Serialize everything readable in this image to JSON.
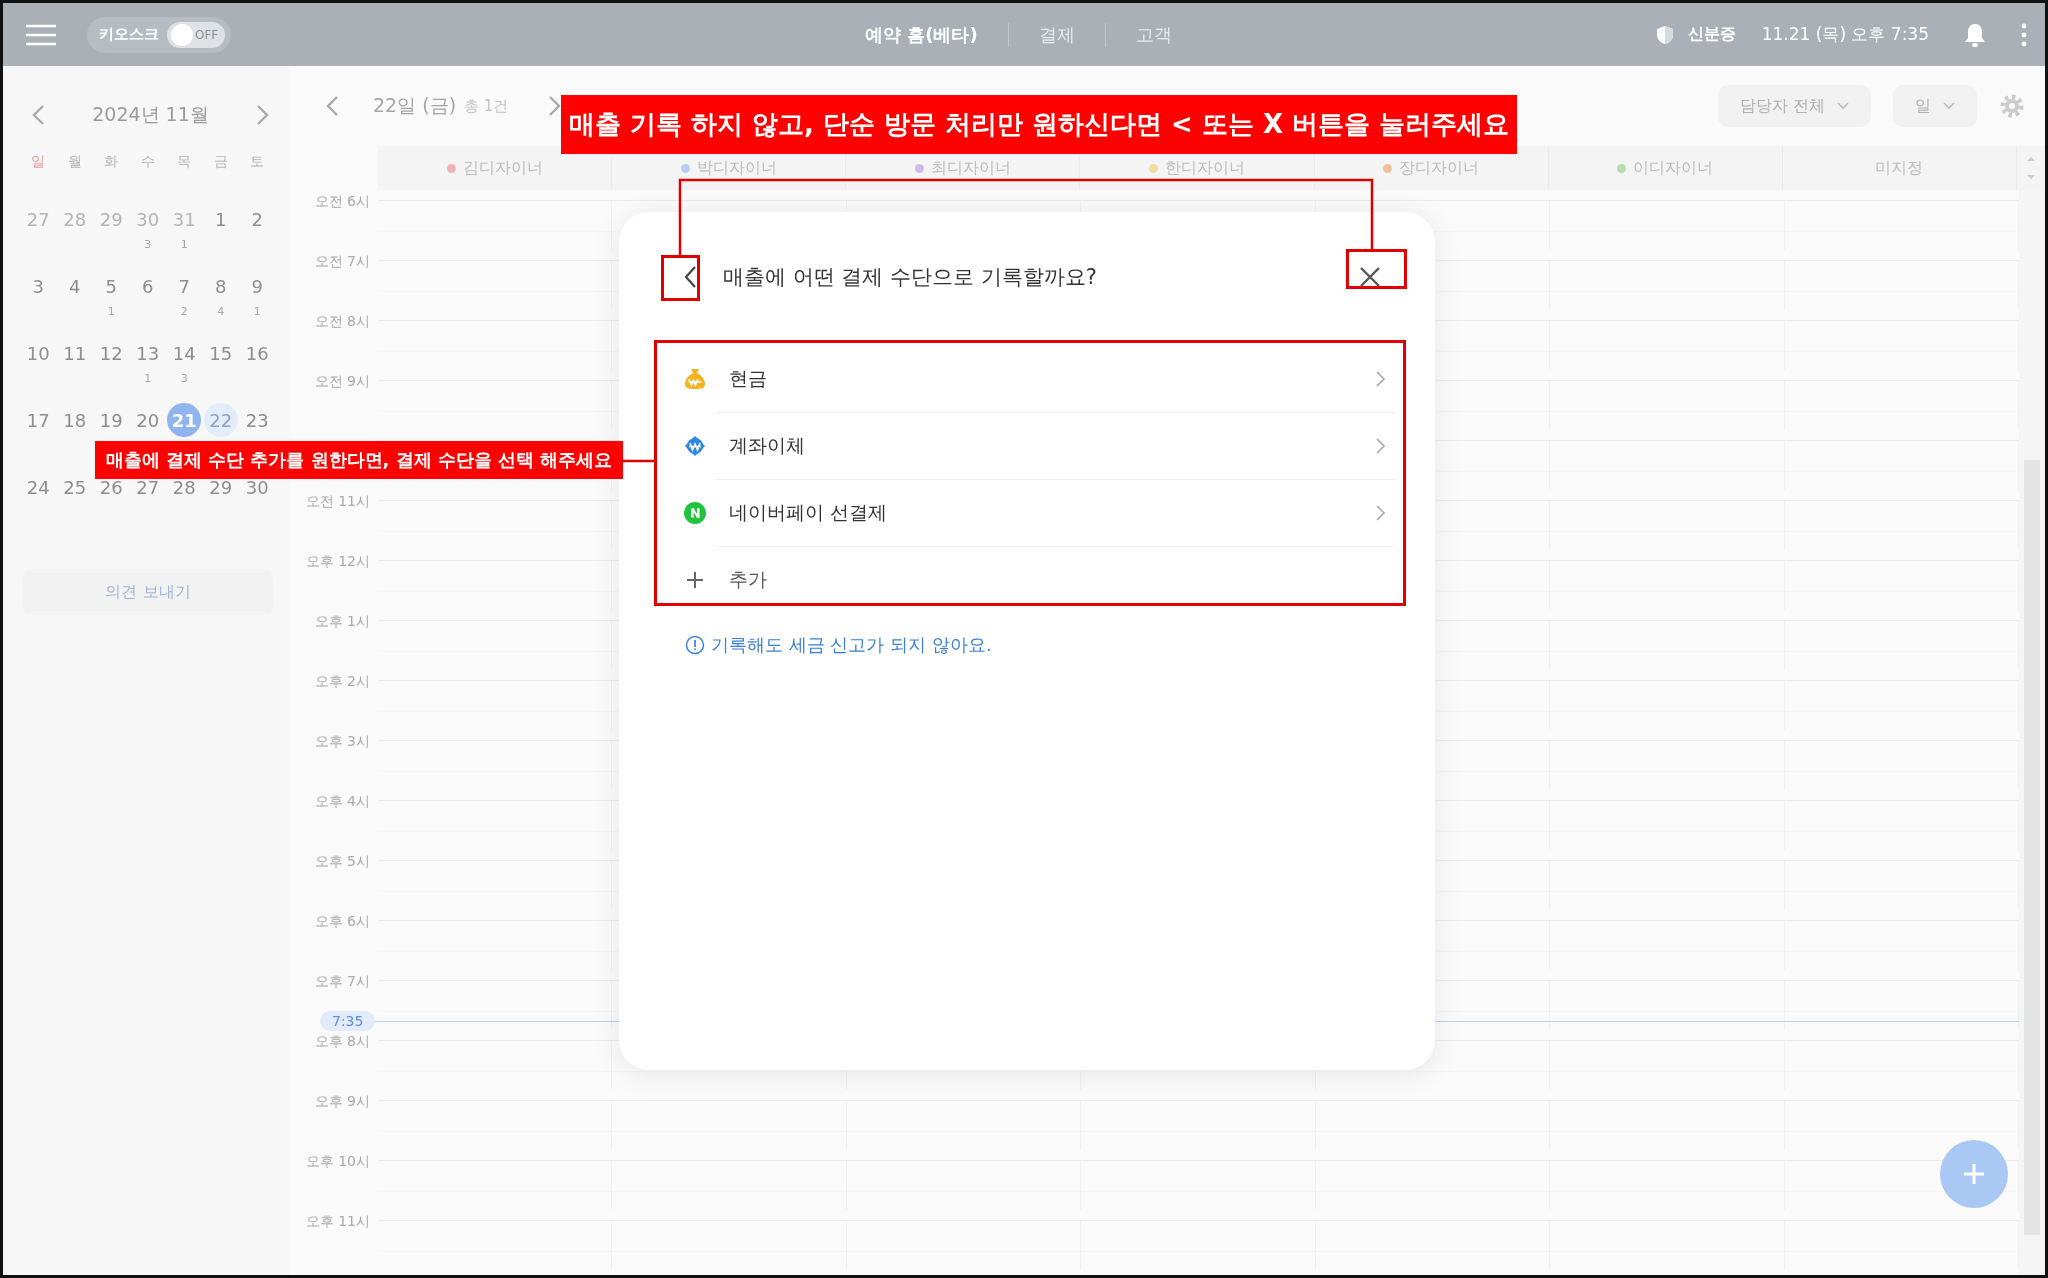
{
  "top_bar": {
    "kiosk": {
      "label": "키오스크",
      "toggle_text": "OFF",
      "on": false
    },
    "nav": [
      {
        "label": "예약 홈(베타)",
        "selected": true
      },
      {
        "label": "결제",
        "selected": false
      },
      {
        "label": "고객",
        "selected": false
      }
    ],
    "id_label": "신분증",
    "datetime": "11.21 (목) 오후 7:35"
  },
  "mini_calendar": {
    "month": "2024년 11월",
    "weekdays": [
      {
        "label": "일",
        "color": "#e8999b"
      },
      {
        "label": "월",
        "color": "#b5b5b5"
      },
      {
        "label": "화",
        "color": "#b5b5b5"
      },
      {
        "label": "수",
        "color": "#b5b5b5"
      },
      {
        "label": "목",
        "color": "#b5b5b5"
      },
      {
        "label": "금",
        "color": "#b5b5b5"
      },
      {
        "label": "토",
        "color": "#b5b5b5"
      }
    ],
    "weeks": [
      [
        {
          "day": "27",
          "outside": true,
          "today": false,
          "selected": false
        },
        {
          "day": "28",
          "outside": true,
          "today": false,
          "selected": false
        },
        {
          "day": "29",
          "outside": true,
          "today": false,
          "selected": false
        },
        {
          "day": "30",
          "outside": true,
          "today": false,
          "selected": false,
          "count": "3"
        },
        {
          "day": "31",
          "outside": true,
          "today": false,
          "selected": false,
          "count": "1"
        },
        {
          "day": "1",
          "outside": false,
          "today": false,
          "selected": false
        },
        {
          "day": "2",
          "outside": false,
          "today": false,
          "selected": false
        }
      ],
      [
        {
          "day": "3",
          "outside": false,
          "today": false,
          "selected": false
        },
        {
          "day": "4",
          "outside": false,
          "today": false,
          "selected": false
        },
        {
          "day": "5",
          "outside": false,
          "today": false,
          "selected": false,
          "count": "1"
        },
        {
          "day": "6",
          "outside": false,
          "today": false,
          "selected": false
        },
        {
          "day": "7",
          "outside": false,
          "today": false,
          "selected": false,
          "count": "2"
        },
        {
          "day": "8",
          "outside": false,
          "today": false,
          "selected": false,
          "count": "4"
        },
        {
          "day": "9",
          "outside": false,
          "today": false,
          "selected": false,
          "count": "1"
        }
      ],
      [
        {
          "day": "10",
          "outside": false,
          "today": false,
          "selected": false
        },
        {
          "day": "11",
          "outside": false,
          "today": false,
          "selected": false
        },
        {
          "day": "12",
          "outside": false,
          "today": false,
          "selected": false
        },
        {
          "day": "13",
          "outside": false,
          "today": false,
          "selected": false,
          "count": "1"
        },
        {
          "day": "14",
          "outside": false,
          "today": false,
          "selected": false,
          "count": "3"
        },
        {
          "day": "15",
          "outside": false,
          "today": false,
          "selected": false
        },
        {
          "day": "16",
          "outside": false,
          "today": false,
          "selected": false
        }
      ],
      [
        {
          "day": "17",
          "outside": false,
          "today": false,
          "selected": false
        },
        {
          "day": "18",
          "outside": false,
          "today": false,
          "selected": false
        },
        {
          "day": "19",
          "outside": false,
          "today": false,
          "selected": false
        },
        {
          "day": "20",
          "outside": false,
          "today": false,
          "selected": false
        },
        {
          "day": "21",
          "outside": false,
          "today": true,
          "selected": false
        },
        {
          "day": "22",
          "outside": false,
          "today": false,
          "selected": true
        },
        {
          "day": "23",
          "outside": false,
          "today": false,
          "selected": false
        }
      ],
      [
        {
          "day": "24",
          "outside": false,
          "today": false,
          "selected": false
        },
        {
          "day": "25",
          "outside": false,
          "today": false,
          "selected": false
        },
        {
          "day": "26",
          "outside": false,
          "today": false,
          "selected": false
        },
        {
          "day": "27",
          "outside": false,
          "today": false,
          "selected": false
        },
        {
          "day": "28",
          "outside": false,
          "today": false,
          "selected": false
        },
        {
          "day": "29",
          "outside": false,
          "today": false,
          "selected": false
        },
        {
          "day": "30",
          "outside": false,
          "today": false,
          "selected": false
        }
      ]
    ],
    "feedback_button": "의견 보내기"
  },
  "schedule": {
    "date_label": "22일 (금)",
    "total": "총 1건",
    "staff_filter": "담당자 전체",
    "view_select": "일",
    "columns": [
      {
        "name": "김디자이너",
        "color": "#f0b4b6"
      },
      {
        "name": "박디자이너",
        "color": "#b7cdf3"
      },
      {
        "name": "최디자이너",
        "color": "#d2b9ee"
      },
      {
        "name": "한디자이너",
        "color": "#f3dca0"
      },
      {
        "name": "장디자이너",
        "color": "#efc09a"
      },
      {
        "name": "이디자이너",
        "color": "#b8dcb0"
      },
      {
        "name": "미지정"
      }
    ],
    "hours": [
      {
        "kind": "labeled",
        "label": "오전 6시"
      },
      {
        "kind": "labeled",
        "label": "오전 7시"
      },
      {
        "kind": "labeled",
        "label": "오전 8시"
      },
      {
        "kind": "labeled",
        "label": "오전 9시"
      },
      {
        "kind": "unlabeled"
      },
      {
        "kind": "labeled",
        "label": "오전 11시"
      },
      {
        "kind": "labeled",
        "label": "오후 12시"
      },
      {
        "kind": "labeled",
        "label": "오후 1시"
      },
      {
        "kind": "labeled",
        "label": "오후 2시"
      },
      {
        "kind": "labeled",
        "label": "오후 3시"
      },
      {
        "kind": "labeled",
        "label": "오후 4시"
      },
      {
        "kind": "labeled",
        "label": "오후 5시"
      },
      {
        "kind": "labeled",
        "label": "오후 6시"
      },
      {
        "kind": "labeled",
        "label": "오후 7시"
      },
      {
        "kind": "labeled",
        "label": "오후 8시"
      },
      {
        "kind": "labeled",
        "label": "오후 9시"
      },
      {
        "kind": "labeled",
        "label": "오후 10시"
      },
      {
        "kind": "labeled",
        "label": "오후 11시"
      }
    ],
    "now_marker": "7:35"
  },
  "dialog": {
    "title": "매출에 어떤 결제 수단으로 기록할까요?",
    "options": [
      {
        "label": "현금",
        "kind": "cash"
      },
      {
        "label": "계좌이체",
        "kind": "transfer"
      },
      {
        "label": "네이버페이 선결제",
        "kind": "npay"
      },
      {
        "label": "추가",
        "kind": "add"
      }
    ],
    "notice": "기록해도 세금 신고가 되지 않아요."
  },
  "annotations": [
    {
      "kind": "top",
      "text": "매출 기록 하지 않고, 단순 방문 처리만 원하신다면 < 또는 X 버튼을 눌러주세요"
    },
    {
      "kind": "left",
      "text": "매출에 결제 수단 추가를 원한다면, 결제 수단을 선택 해주세요"
    }
  ]
}
